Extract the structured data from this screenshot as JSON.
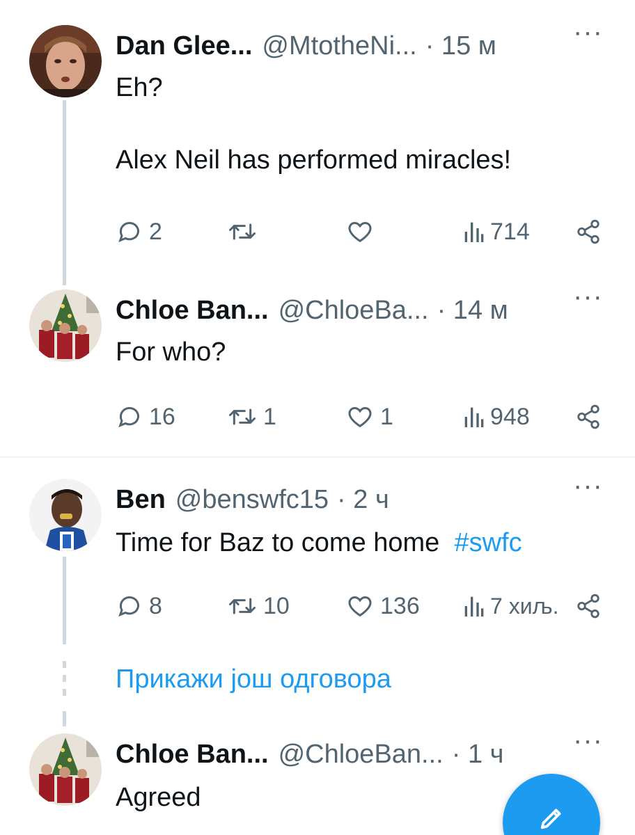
{
  "tweets": [
    {
      "name": "Dan Glee...",
      "handle": "@MtotheNi...",
      "time": "· 15 м",
      "text": "Eh?\n\nAlex Neil has performed miracles!",
      "replies": "2",
      "retweets": "",
      "likes": "",
      "views": "714"
    },
    {
      "name": "Chloe Ban...",
      "handle": "@ChloeBa...",
      "time": "· 14 м",
      "text": "For who?",
      "replies": "16",
      "retweets": "1",
      "likes": "1",
      "views": "948"
    },
    {
      "name": "Ben",
      "handle": "@benswfc15",
      "time": "· 2 ч",
      "text": "Time for Baz to come home",
      "hashtag": "#swfc",
      "replies": "8",
      "retweets": "10",
      "likes": "136",
      "views": "7 хиљ."
    },
    {
      "name": "Chloe Ban...",
      "handle": "@ChloeBan...",
      "time": "· 1 ч",
      "text": "Agreed"
    }
  ],
  "show_more_replies": "Прикажи још одговора",
  "more_menu": "···",
  "icons": {
    "reply": "reply-icon",
    "retweet": "retweet-icon",
    "like": "heart-icon",
    "views": "views-icon",
    "share": "share-icon",
    "compose": "compose-icon"
  },
  "colors": {
    "accent": "#1d9bf0",
    "muted": "#536471",
    "text": "#0f1419",
    "thread_line": "#cfd9de"
  }
}
